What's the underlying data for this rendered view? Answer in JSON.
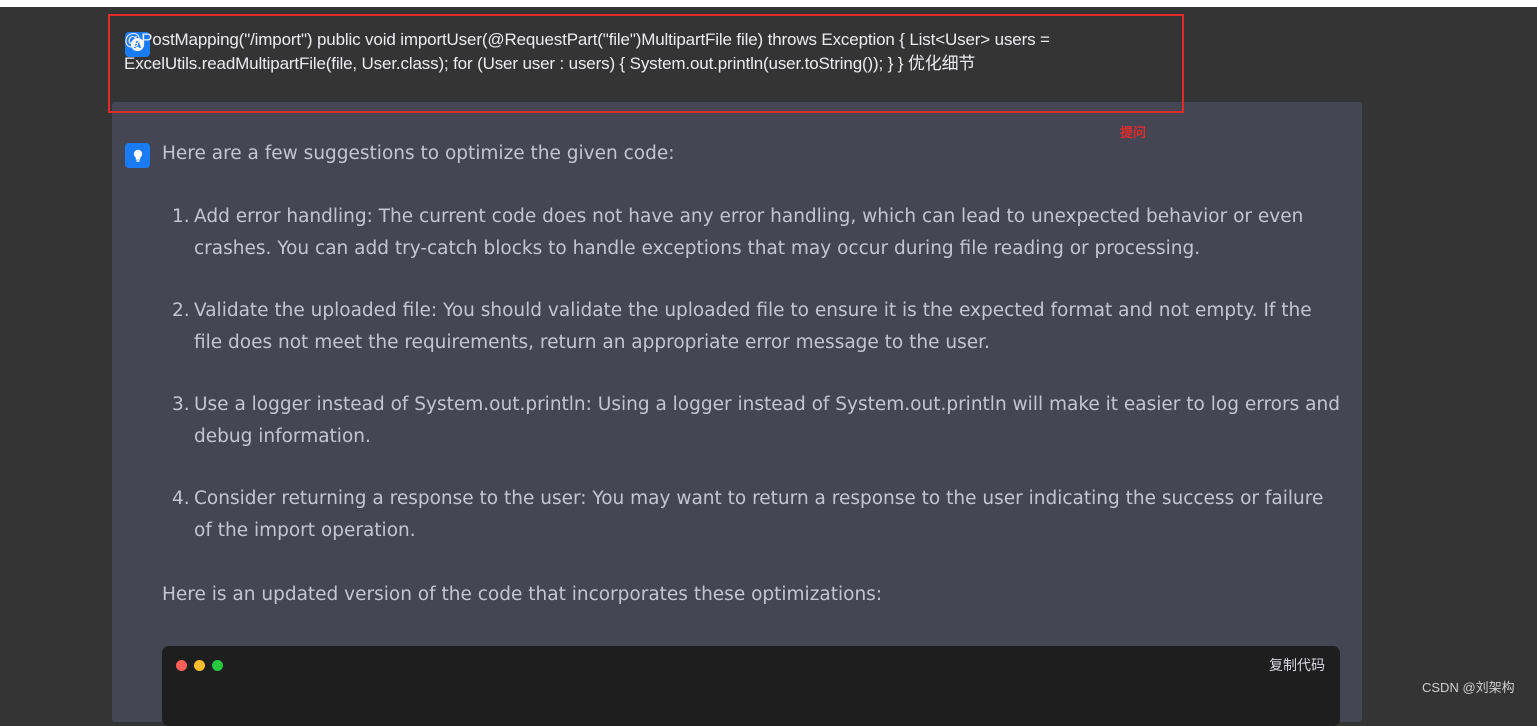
{
  "question": {
    "text": "@PostMapping(\"/import\") public void importUser(@RequestPart(\"file\")MultipartFile file) throws Exception { List<User> users = ExcelUtils.readMultipartFile(file, User.class); for (User user : users) { System.out.println(user.toString()); } } 优化细节",
    "annotation": "提问",
    "avatar_icon": "user-avatar-icon"
  },
  "answer": {
    "avatar_icon": "bulb-icon",
    "intro": "Here are a few suggestions to optimize the given code:",
    "items": [
      {
        "num": "1.",
        "text": "Add error handling: The current code does not have any error handling, which can lead to unexpected behavior or even crashes. You can add try-catch blocks to handle exceptions that may occur during file reading or processing."
      },
      {
        "num": "2.",
        "text": "Validate the uploaded file: You should validate the uploaded file to ensure it is the expected format and not empty. If the file does not meet the requirements, return an appropriate error message to the user."
      },
      {
        "num": "3.",
        "text": "Use a logger instead of System.out.println: Using a logger instead of System.out.println will make it easier to log errors and debug information."
      },
      {
        "num": "4.",
        "text": "Consider returning a response to the user: You may want to return a response to the user indicating the success or failure of the import operation."
      }
    ],
    "outro": "Here is an updated version of the code that incorporates these optimizations:",
    "code_copy_label": "复制代码"
  },
  "watermark": "CSDN @刘架构",
  "colors": {
    "accent": "#1a7cf5",
    "highlight": "#e02b2b",
    "card_bg": "#444654",
    "page_bg": "#343434",
    "code_bg": "#1e1e1e"
  }
}
